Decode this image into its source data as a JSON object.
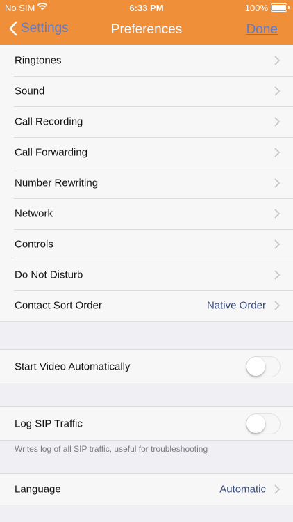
{
  "status_bar": {
    "carrier": "No SIM",
    "time": "6:33 PM",
    "battery": "100%"
  },
  "nav": {
    "back_label": "Settings",
    "title": "Preferences",
    "done_label": "Done"
  },
  "main_list": [
    {
      "label": "Ringtones"
    },
    {
      "label": "Sound"
    },
    {
      "label": "Call Recording"
    },
    {
      "label": "Call Forwarding"
    },
    {
      "label": "Number Rewriting"
    },
    {
      "label": "Network"
    },
    {
      "label": "Controls"
    },
    {
      "label": "Do Not Disturb"
    },
    {
      "label": "Contact Sort Order",
      "value": "Native Order"
    }
  ],
  "video": {
    "label": "Start Video Automatically",
    "on": false
  },
  "sip": {
    "label": "Log SIP Traffic",
    "on": false,
    "footnote": "Writes log of all SIP traffic, useful for troubleshooting"
  },
  "language": {
    "label": "Language",
    "value": "Automatic"
  },
  "colors": {
    "nav_bar": "#f08f3a",
    "link": "#5a7bd0",
    "value_text": "#36497a"
  }
}
